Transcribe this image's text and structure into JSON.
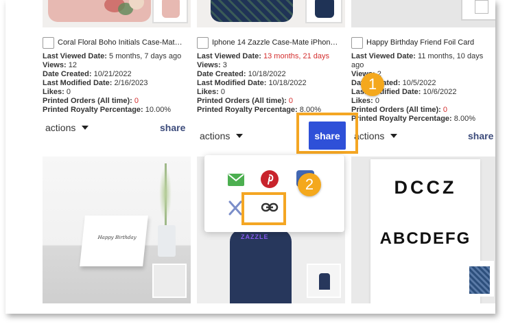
{
  "labels": {
    "last_viewed": "Last Viewed Date:",
    "views": "Views:",
    "date_created": "Date Created:",
    "last_modified": "Last Modified Date:",
    "likes": "Likes:",
    "printed_orders": "Printed Orders (All time):",
    "royalty": "Printed Royalty Percentage:",
    "actions": "actions",
    "share": "share"
  },
  "products": [
    {
      "title": "Coral Floral Boho Initials Case-Mat…",
      "last_viewed": "5 months, 7 days ago",
      "views": "12",
      "date_created": "10/21/2022",
      "last_modified": "2/16/2023",
      "likes": "0",
      "printed_orders": "0",
      "royalty": "10.00%"
    },
    {
      "title": "Iphone 14 Zazzle Case-Mate iPhon…",
      "last_viewed": "13 months, 21 days",
      "views": "3",
      "date_created": "10/18/2022",
      "last_modified": "10/18/2022",
      "likes": "0",
      "printed_orders": "0",
      "royalty": "8.00%"
    },
    {
      "title": "Happy Birthday Friend Foil Card",
      "last_viewed": "11 months, 10 days",
      "last_viewed_suffix": "ago",
      "views": "2",
      "date_created": "10/5/2022",
      "last_modified": "10/6/2022",
      "likes": "0",
      "printed_orders": "0",
      "royalty": "8.00%"
    }
  ],
  "thumbnails": {
    "birthday_card_text": "Happy Birthday",
    "tshirt_text": "ZAZZLE",
    "letter_card_line1": "DCCZ",
    "letter_card_line2": "ABCDEFG"
  },
  "callouts": {
    "one": "1",
    "two": "2"
  },
  "colors": {
    "share_button": "#2e50d8",
    "highlight": "#f4a623",
    "warning_text": "#d42e2e",
    "email": "#4caf50",
    "pinterest": "#c8232c",
    "facebook": "#4267b2"
  },
  "icons": [
    "email-icon",
    "pinterest-icon",
    "facebook-icon",
    "x-twitter-icon",
    "link-icon",
    "chevron-down-icon"
  ]
}
